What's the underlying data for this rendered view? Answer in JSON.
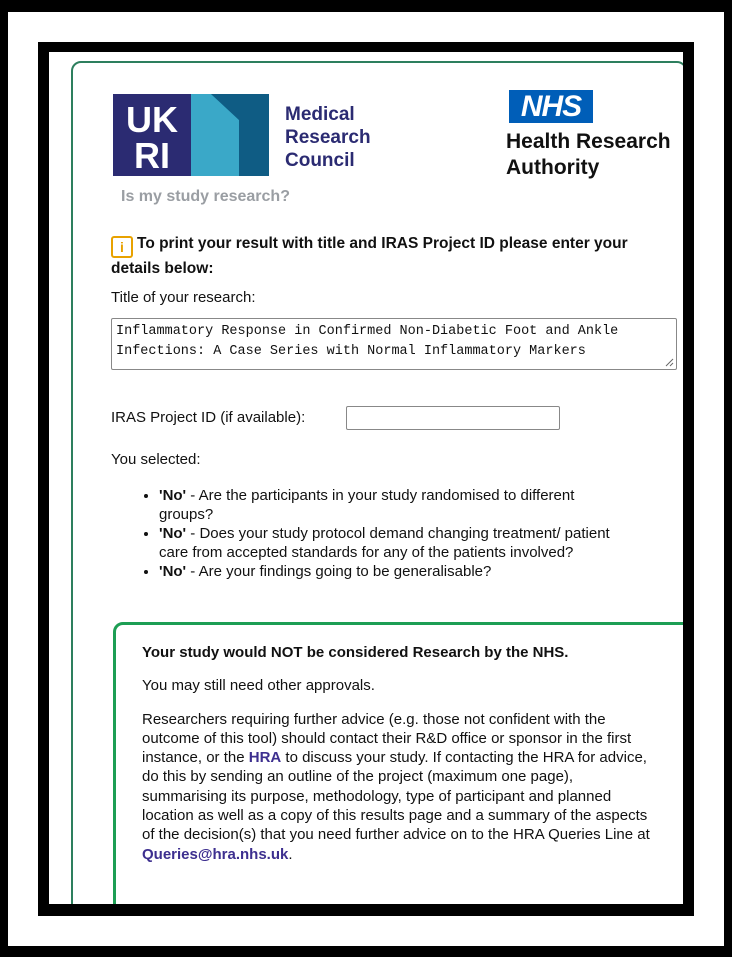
{
  "logos": {
    "ukri": {
      "text": "UKRI"
    },
    "mrc": {
      "line1": "Medical",
      "line2": "Research",
      "line3": "Council"
    },
    "nhs": {
      "badge": "NHS",
      "line1": "Health Research",
      "line2": "Authority"
    }
  },
  "subtitle": "Is my study research?",
  "info": {
    "icon": "info-icon",
    "text": "To print your result with title and IRAS Project ID please enter your details below:"
  },
  "form": {
    "title_label": "Title of your research:",
    "title_value": "Inflammatory Response in Confirmed Non-Diabetic Foot and Ankle Infections: A Case Series with Normal Inflammatory Markers",
    "iras_label": "IRAS Project ID (if available):",
    "iras_value": ""
  },
  "selected": {
    "label": "You selected:",
    "items": [
      {
        "answer": "'No'",
        "text": " - Are the participants in your study randomised to different groups?"
      },
      {
        "answer": "'No'",
        "text": " - Does your study protocol demand changing treatment/ patient care from accepted standards for any of the patients involved?"
      },
      {
        "answer": "'No'",
        "text": " - Are your findings going to be generalisable?"
      }
    ]
  },
  "result": {
    "heading": "Your study would NOT be considered Research by the NHS.",
    "note": "You may still need other approvals.",
    "advice_part1": "Researchers requiring further advice (e.g. those not confident with the outcome of this tool) should contact their R&D office or sponsor in the first instance, or the ",
    "hra_link": "HRA",
    "advice_part2": " to discuss your study. If contacting the HRA for advice, do this by sending an outline of the project (maximum one page), summarising its purpose, methodology, type of participant and planned location as well as a copy of this results page and a summary of the aspects of the decision(s) that you need further advice on to the HRA Queries Line at ",
    "email": "Queries@hra.nhs.uk",
    "advice_end": "."
  },
  "colors": {
    "nhs_blue": "#005eb8",
    "mrc_navy": "#2b2b72",
    "ukri_teal": "#1a8bb0",
    "result_green": "#1d9e54",
    "info_amber": "#e8a200"
  }
}
